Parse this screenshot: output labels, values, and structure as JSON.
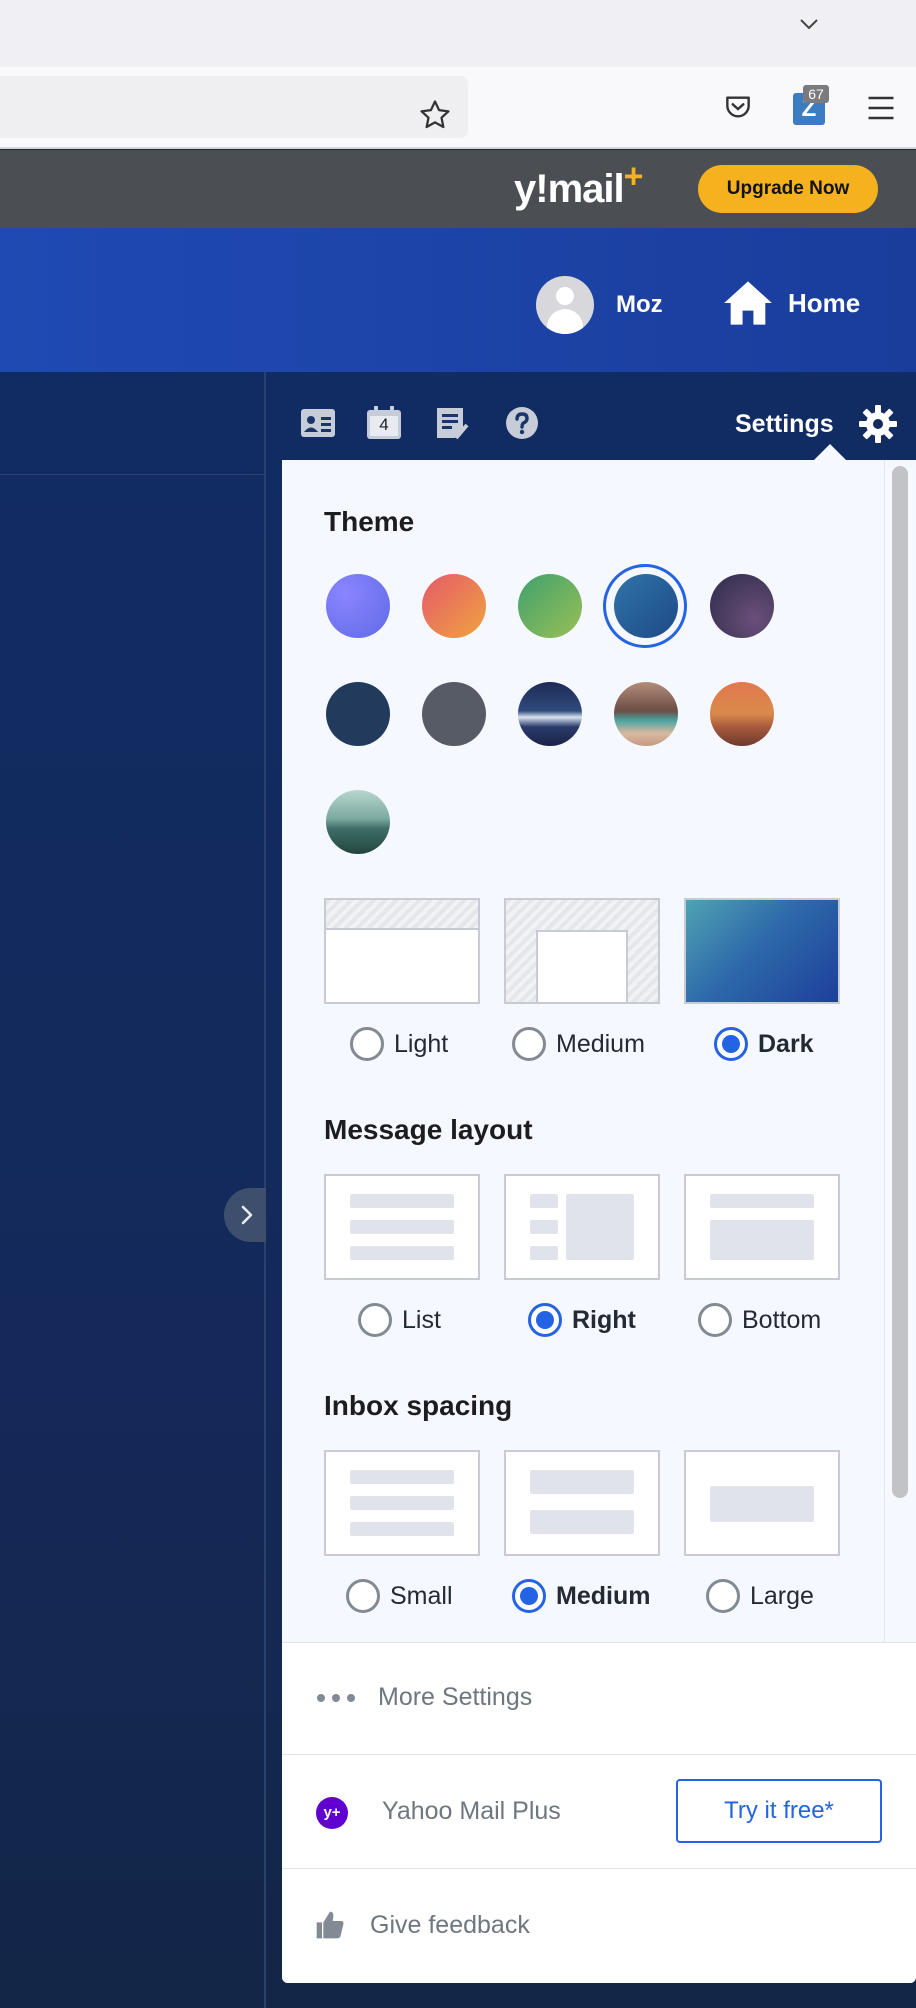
{
  "browser": {
    "extension_badge": "67",
    "extension_letter": "Z"
  },
  "promo": {
    "logo_text": "y!mail",
    "logo_plus": "+",
    "upgrade_label": "Upgrade Now"
  },
  "header": {
    "profile_name": "Moz",
    "home_label": "Home"
  },
  "toolbar": {
    "calendar_day": "4",
    "settings_label": "Settings"
  },
  "settings": {
    "theme": {
      "title": "Theme",
      "options": [
        {
          "label": "Light",
          "selected": false
        },
        {
          "label": "Medium",
          "selected": false
        },
        {
          "label": "Dark",
          "selected": true
        }
      ]
    },
    "message_layout": {
      "title": "Message layout",
      "options": [
        {
          "label": "List",
          "selected": false
        },
        {
          "label": "Right",
          "selected": true
        },
        {
          "label": "Bottom",
          "selected": false
        }
      ]
    },
    "inbox_spacing": {
      "title": "Inbox spacing",
      "options": [
        {
          "label": "Small",
          "selected": false
        },
        {
          "label": "Medium",
          "selected": true
        },
        {
          "label": "Large",
          "selected": false
        }
      ]
    }
  },
  "footer": {
    "more_settings": "More Settings",
    "mail_plus_icon": "y+",
    "mail_plus_label": "Yahoo Mail Plus",
    "try_free": "Try it free*",
    "feedback": "Give feedback"
  },
  "colors": {
    "accent": "#2463e4",
    "promo_bar": "#4b4f54",
    "upgrade": "#f5b21e",
    "header": "#1f4ab3",
    "yahoo_purple": "#6001d2"
  }
}
